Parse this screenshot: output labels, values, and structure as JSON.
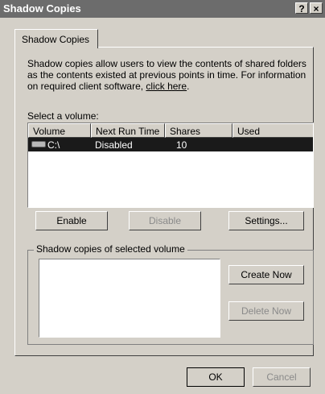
{
  "window": {
    "title": "Shadow Copies",
    "help_label": "?",
    "close_label": "×"
  },
  "tabs": [
    {
      "label": "Shadow Copies"
    }
  ],
  "description": {
    "text": "Shadow copies allow users to view the contents of shared folders as the contents existed at previous points in time. For information on required client software, ",
    "link": "click here",
    "after": "."
  },
  "volume_select": {
    "label": "Select a volume:",
    "columns": [
      "Volume",
      "Next Run Time",
      "Shares",
      "Used"
    ],
    "rows": [
      {
        "volume": "C:\\",
        "next_run": "Disabled",
        "shares": "10",
        "used": "",
        "selected": true
      }
    ]
  },
  "buttons": {
    "enable": "Enable",
    "disable": "Disable",
    "settings": "Settings...",
    "create_now": "Create Now",
    "delete_now": "Delete Now",
    "ok": "OK",
    "cancel": "Cancel"
  },
  "shadow_copies_group": {
    "label": "Shadow copies of selected volume"
  }
}
